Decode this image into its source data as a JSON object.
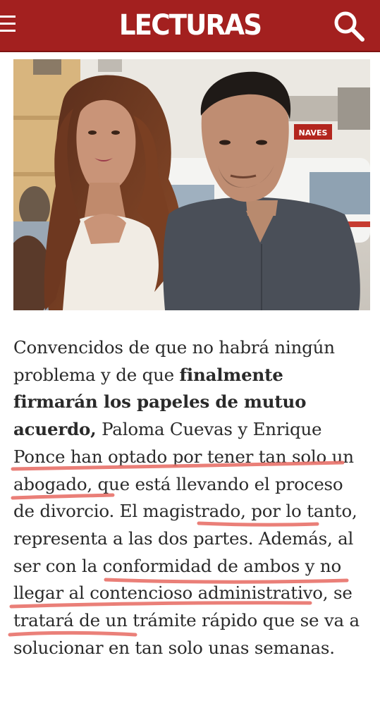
{
  "header": {
    "brand": "LECTURAS",
    "menu_icon": "hamburger-menu-icon",
    "search_icon": "search-icon",
    "background_color": "#a3201f"
  },
  "article": {
    "text_1": "Convencidos de que no habrá ningún problema y de que ",
    "bold_1": "finalmente firmarán los papeles de mutuo acuerdo,",
    "text_2": " Paloma Cuevas y Enrique Ponce han optado por tener tan solo un abogado, que está llevando el proceso de divorcio. El magistrado, por lo tanto, representa a las dos partes. Además, al ser con la conformidad de ambos y no llegar al contencioso administrativo, se tratará de un trámite rápido que se va a solucionar en tan solo unas semanas."
  },
  "photo": {
    "sign_text": "NAVES"
  },
  "annotation_color": "#e8726a"
}
